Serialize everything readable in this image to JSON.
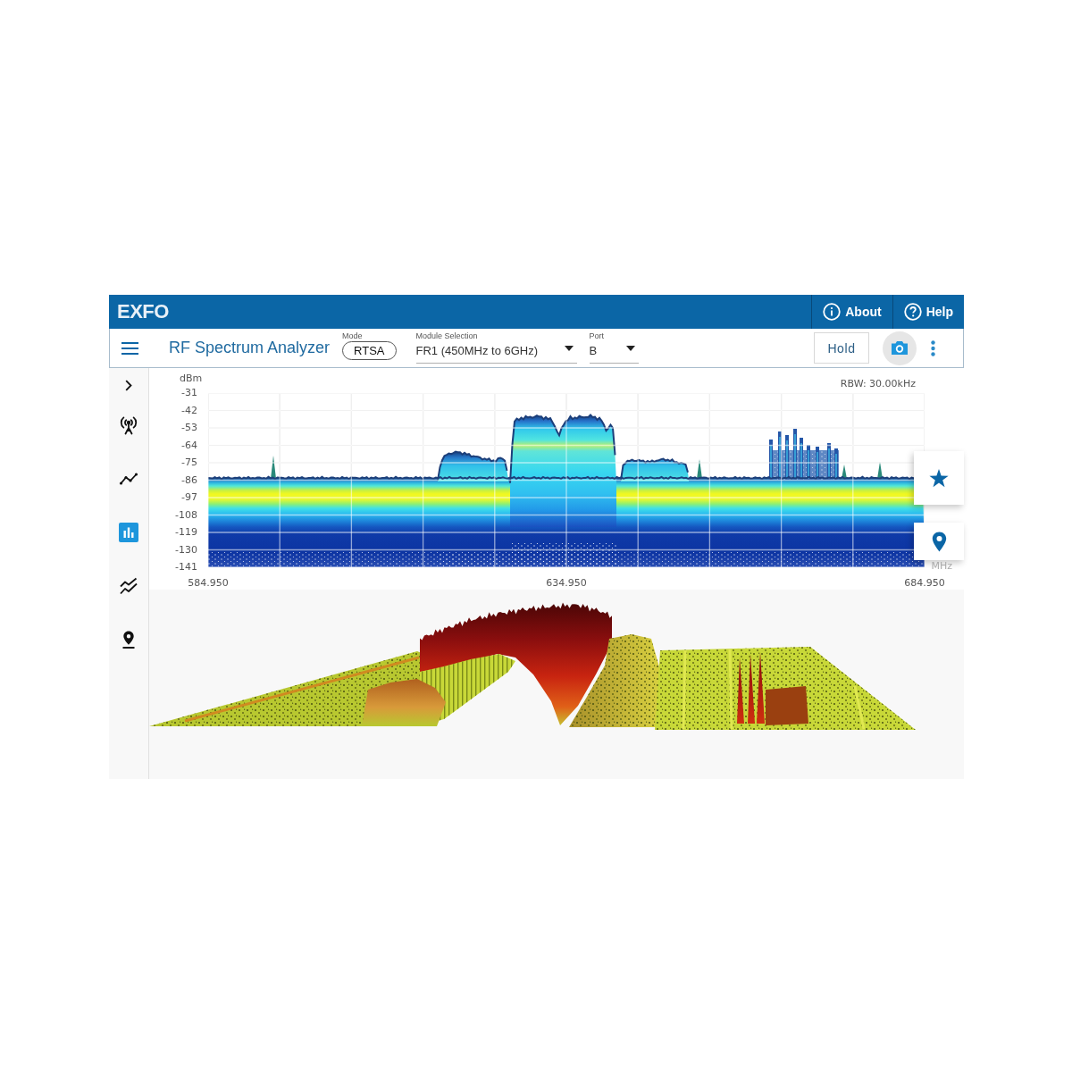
{
  "header": {
    "logo": "EXFO",
    "links": [
      {
        "kind": "about",
        "label": "About"
      },
      {
        "kind": "help",
        "label": "Help"
      }
    ]
  },
  "toolbar": {
    "title": "RF Spectrum Analyzer",
    "mode": {
      "label": "Mode",
      "value": "RTSA"
    },
    "module_selection": {
      "label": "Module Selection",
      "value": "FR1 (450MHz to 6GHz)"
    },
    "port": {
      "label": "Port",
      "value": "B"
    },
    "hold_button": "Hold"
  },
  "sidebar": {
    "items": [
      {
        "kind": "antenna",
        "selected": false
      },
      {
        "kind": "trace",
        "selected": false
      },
      {
        "kind": "spectrum",
        "selected": true
      },
      {
        "kind": "multi_trace",
        "selected": false
      },
      {
        "kind": "location",
        "selected": false
      }
    ]
  },
  "spectrum": {
    "y_unit": "dBm",
    "rbw": "RBW: 30.00kHz",
    "y_ticks": [
      "-31",
      "-42",
      "-53",
      "-64",
      "-75",
      "-86",
      "-97",
      "-108",
      "-119",
      "-130",
      "-141"
    ],
    "x_unit": "MHz",
    "x_ticks": [
      "584.950",
      "634.950",
      "684.950"
    ]
  }
}
